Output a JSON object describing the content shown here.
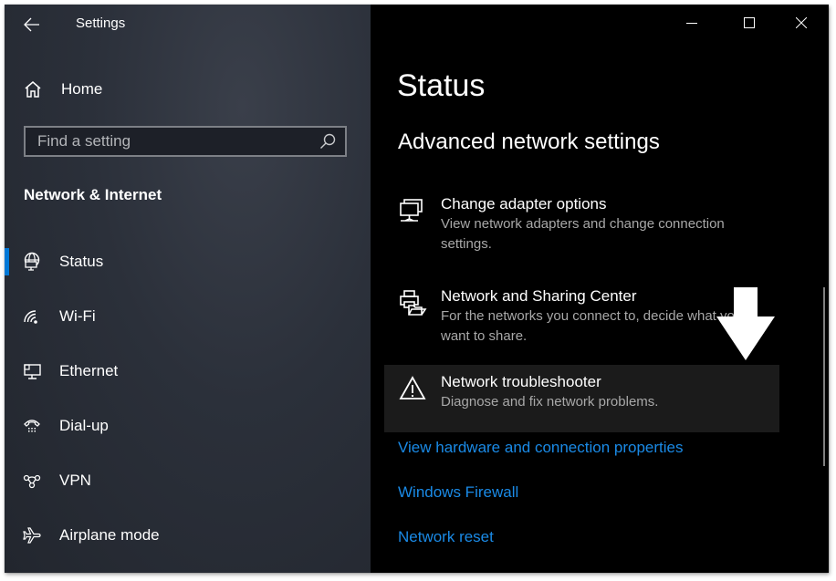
{
  "window": {
    "app_title": "Settings",
    "controls": {
      "minimize": "minimize-icon",
      "maximize": "maximize-icon",
      "close": "close-icon"
    }
  },
  "sidebar": {
    "back_icon": "arrow-left-icon",
    "home": {
      "label": "Home",
      "icon": "home-icon"
    },
    "search": {
      "placeholder": "Find a setting",
      "value": "",
      "icon": "search-icon"
    },
    "section_title": "Network & Internet",
    "items": [
      {
        "label": "Status",
        "icon": "globe-monitor-icon",
        "selected": true
      },
      {
        "label": "Wi-Fi",
        "icon": "wifi-icon",
        "selected": false
      },
      {
        "label": "Ethernet",
        "icon": "ethernet-icon",
        "selected": false
      },
      {
        "label": "Dial-up",
        "icon": "phone-icon",
        "selected": false
      },
      {
        "label": "VPN",
        "icon": "vpn-icon",
        "selected": false
      },
      {
        "label": "Airplane mode",
        "icon": "airplane-icon",
        "selected": false
      }
    ]
  },
  "main": {
    "page_title": "Status",
    "section_title": "Advanced network settings",
    "options": [
      {
        "name": "Change adapter options",
        "description": "View network adapters and change connection settings.",
        "icon": "network-adapter-icon"
      },
      {
        "name": "Network and Sharing Center",
        "description": "For the networks you connect to, decide what you want to share.",
        "icon": "sharing-center-icon"
      },
      {
        "name": "Network troubleshooter",
        "description": "Diagnose and fix network problems.",
        "icon": "warning-icon",
        "highlighted": true
      }
    ],
    "links": [
      "View hardware and connection properties",
      "Windows Firewall",
      "Network reset"
    ]
  },
  "annotation": {
    "type": "arrow-down-icon",
    "color": "#ffffff"
  },
  "colors": {
    "accent": "#0078d7",
    "link": "#1a8ae6",
    "sidebar_bg": "#2b303a",
    "main_bg": "#000000",
    "description": "#a8a8a8"
  }
}
